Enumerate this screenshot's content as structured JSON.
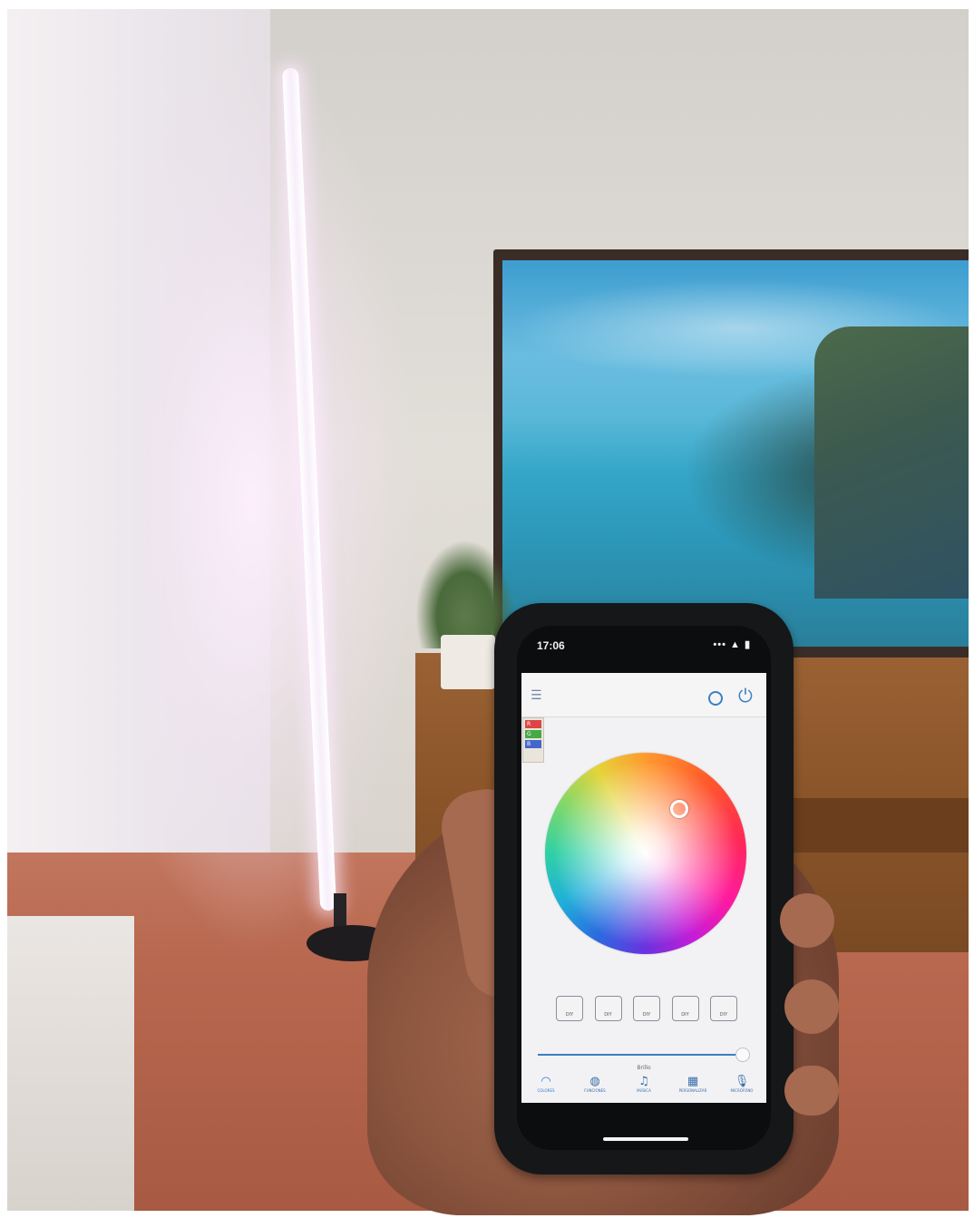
{
  "phone": {
    "status_time": "17:06",
    "status_icons": "••• ▲ ▮"
  },
  "app": {
    "rgb_rows": [
      "R",
      "G",
      "B"
    ],
    "diy_buttons": [
      "DIY",
      "DIY",
      "DIY",
      "DIY",
      "DIY"
    ],
    "brightness_label": "Brillo",
    "brightness_level": 0.97,
    "tabs": [
      "COLORES",
      "FUNCIONES",
      "MÚSICA",
      "PERSONALIZAR",
      "MICRÓFONO"
    ],
    "active_tab": "COLORES",
    "accent_color": "#3b7fc4"
  },
  "icons": {
    "menu": "menu-icon",
    "alarm": "alarm-icon",
    "power": "power-icon",
    "tab_icons": [
      "colors-icon",
      "functions-icon",
      "music-note-icon",
      "grid-icon",
      "microphone-icon"
    ]
  }
}
